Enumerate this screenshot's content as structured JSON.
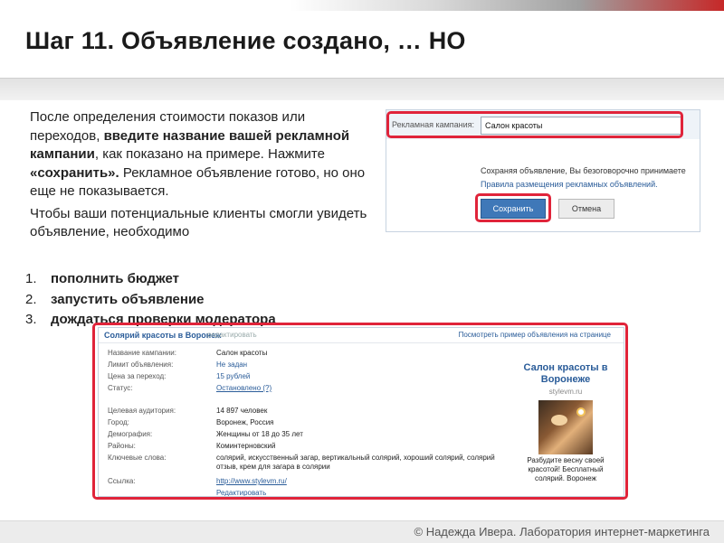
{
  "slide": {
    "title": "Шаг 11. Объявление создано, … НО",
    "para1": {
      "t1": "После определения стоимости показов или переходов, ",
      "b1": "введите название вашей рекламной кампании",
      "t2": ", как показано на примере. Нажмите ",
      "b2": "«сохранить».",
      "t3": " Рекламное объявление готово, но оно еще не показывается."
    },
    "para2": "Чтобы ваши потенциальные клиенты смогли увидеть объявление, необходимо",
    "steps": [
      {
        "num": "1.",
        "text": "пополнить бюджет"
      },
      {
        "num": "2.",
        "text": "запустить объявление"
      },
      {
        "num": "3.",
        "text": "дождаться проверки модератора"
      }
    ],
    "footer": "© Надежда Ивера. Лаборатория интернет-маркетинга"
  },
  "campaign_form": {
    "label": "Рекламная кампания:",
    "value": "Салон красоты",
    "agree_text": "Сохраняя объявление, Вы безоговорочно принимаете",
    "rules_link": "Правила размещения рекламных объявлений.",
    "save_label": "Сохранить",
    "cancel_label": "Отмена"
  },
  "ad_summary": {
    "title": "Солярий красоты в Воронеж",
    "edit_label": "редактировать",
    "preview_link": "Посмотреть пример объявления на странице",
    "rows": [
      {
        "k": "Название кампании:",
        "v": "Салон красоты",
        "style": ""
      },
      {
        "k": "Лимит объявления:",
        "v": "Не задан",
        "style": "link"
      },
      {
        "k": "Цена за переход:",
        "v": "15 рублей",
        "style": "link"
      },
      {
        "k": "Статус:",
        "v": "Остановлено (?)",
        "style": "linkul"
      },
      {
        "k": "Целевая аудитория:",
        "v": "14 897 человек",
        "style": ""
      },
      {
        "k": "Город:",
        "v": "Воронеж, Россия",
        "style": ""
      },
      {
        "k": "Демография:",
        "v": "Женщины от 18 до 35 лет",
        "style": ""
      },
      {
        "k": "Районы:",
        "v": "Коминтерновский",
        "style": ""
      },
      {
        "k": "Ключевые слова:",
        "v": "солярий, искусственный загар, вертикальный солярий, хороший солярий, солярий отзыв, крем для загара в солярии",
        "style": ""
      },
      {
        "k": "Ссылка:",
        "v": "http://www.stylevm.ru/",
        "style": "linkul"
      },
      {
        "k": "",
        "v": "Редактировать",
        "style": "linkul"
      }
    ],
    "ad_preview": {
      "title": "Салон красоты в Воронеже",
      "site": "stylevm.ru",
      "text": "Разбудите весну своей красотой! Бесплатный солярий. Воронеж"
    }
  },
  "colors": {
    "accent_red": "#e0243a",
    "button_blue": "#3f78b8",
    "link_blue": "#2a5c99"
  }
}
